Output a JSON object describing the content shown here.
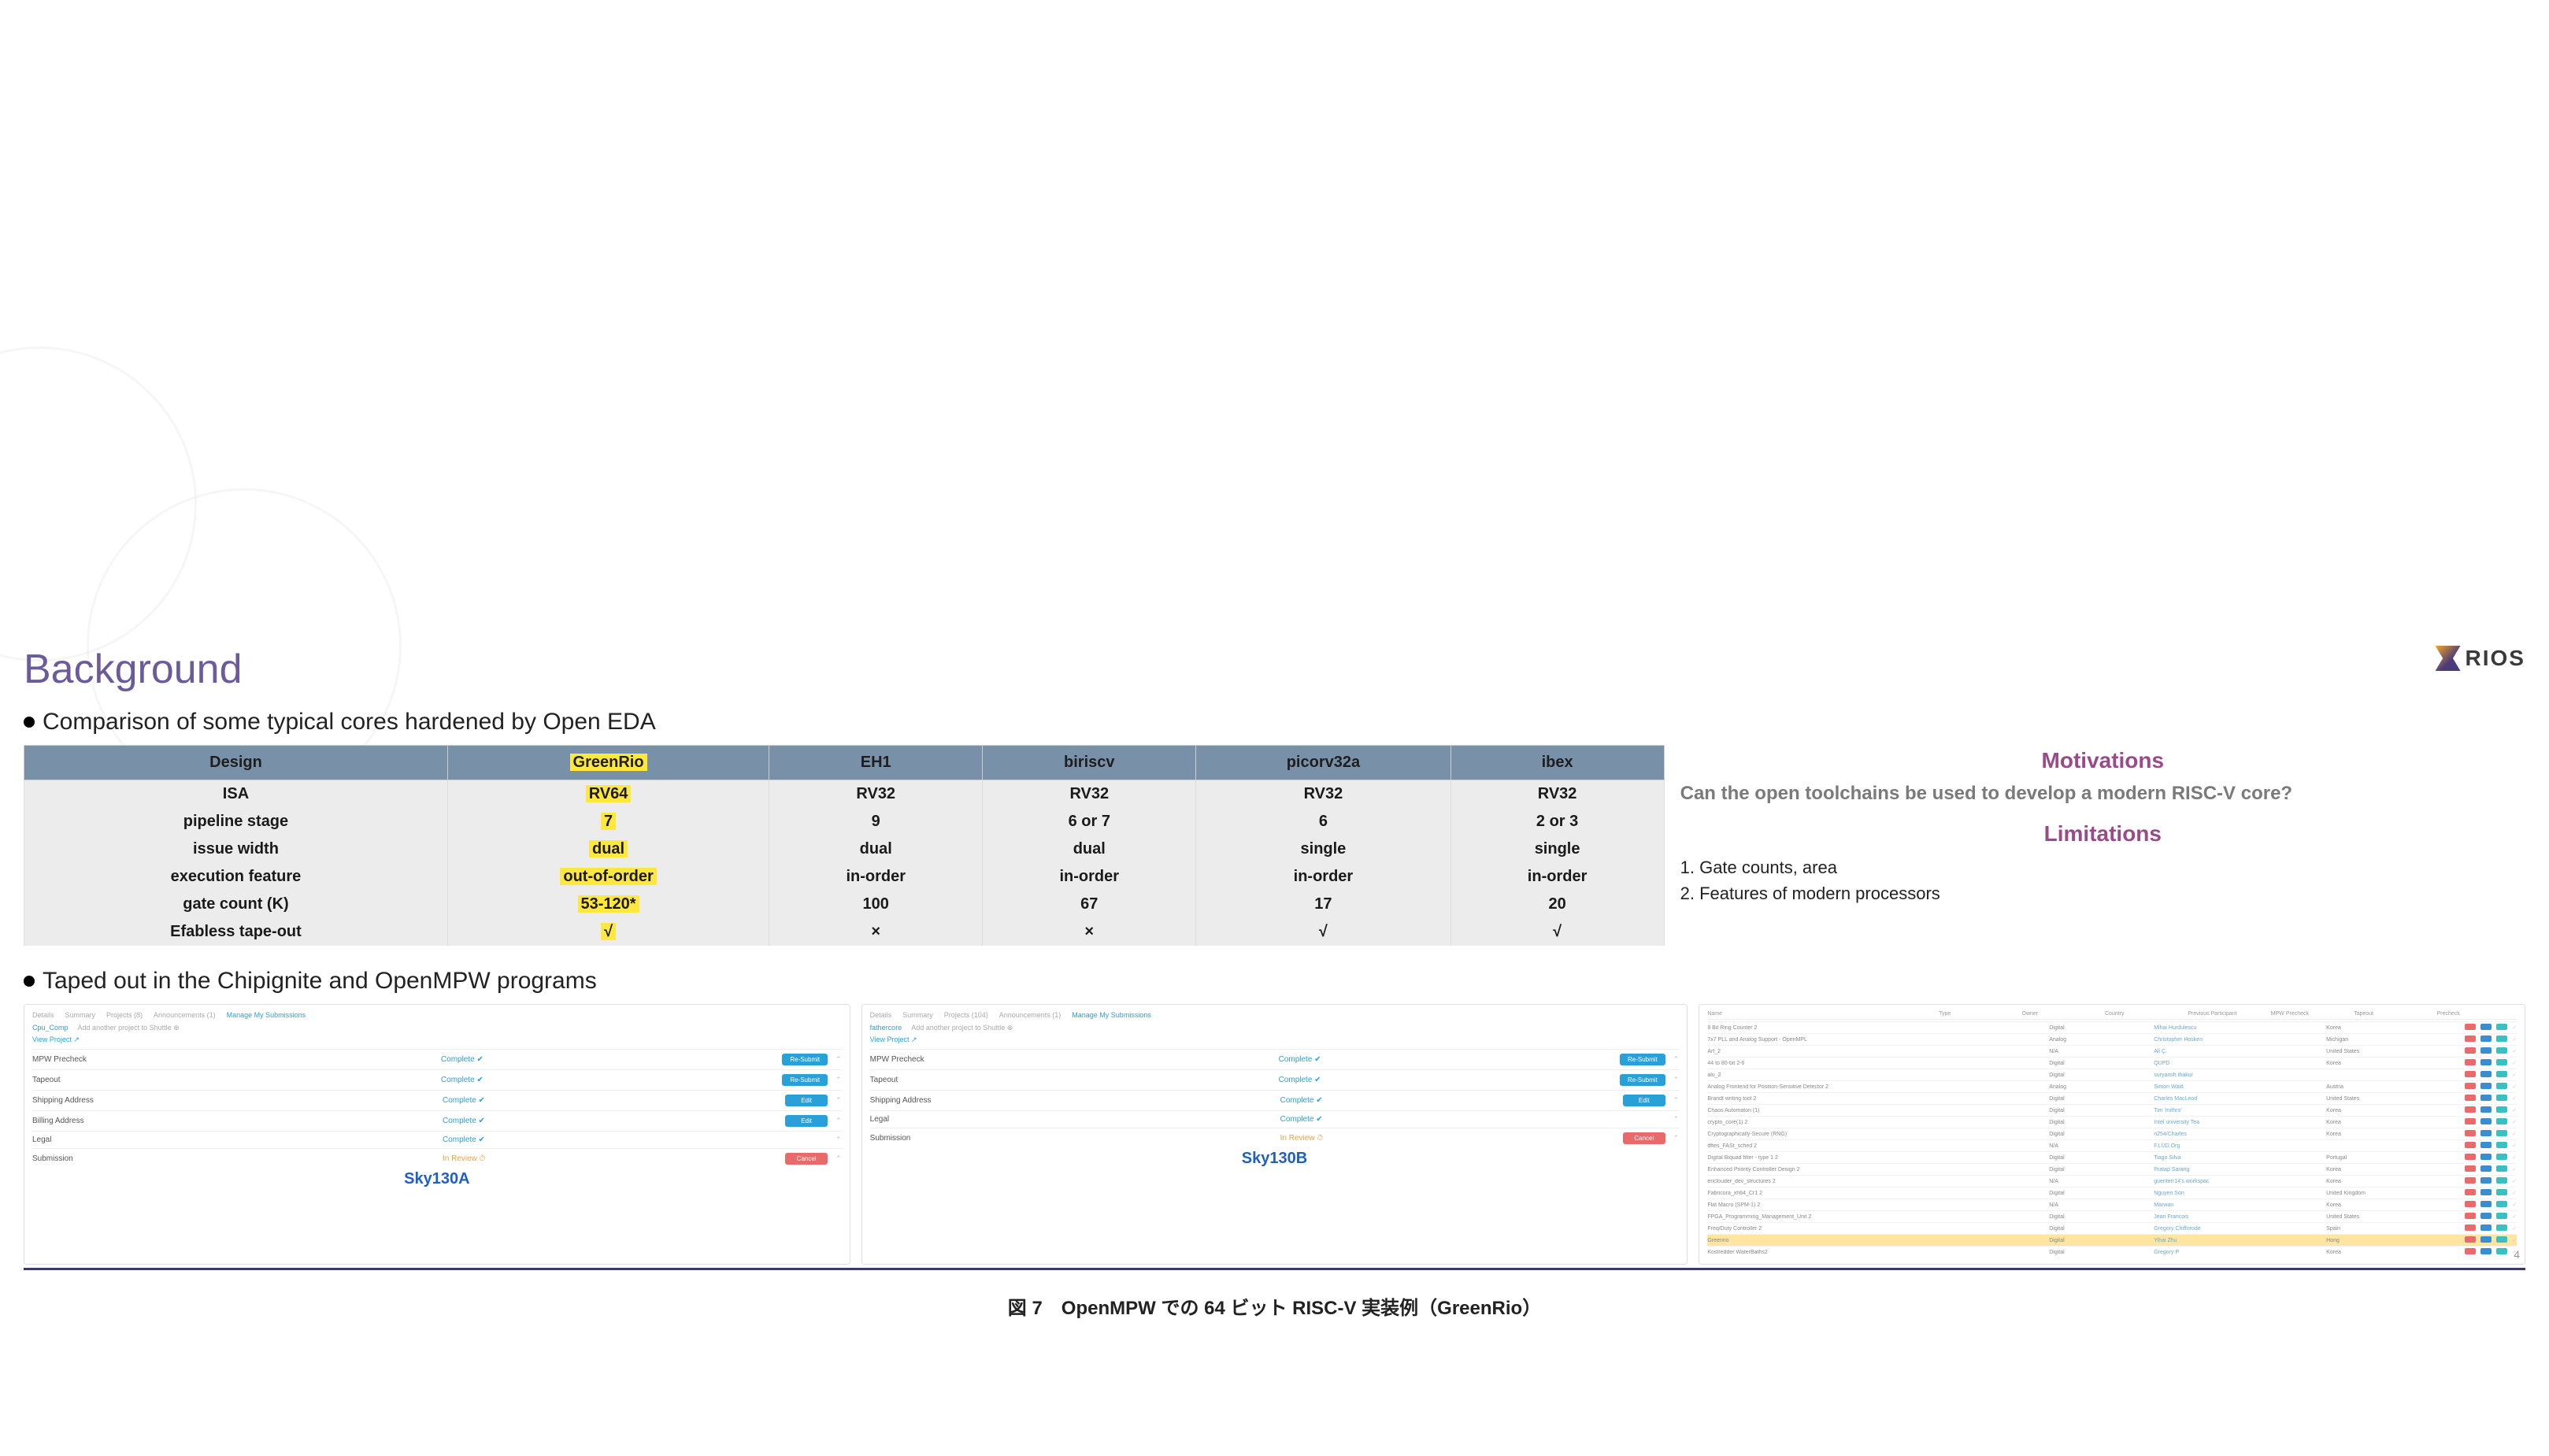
{
  "logo": {
    "text": "RIOS"
  },
  "title": "Background",
  "bullet1": "Comparison of some typical cores hardened by Open EDA",
  "bullet2": "Taped out in the Chipignite and OpenMPW programs",
  "table": {
    "headers": [
      "Design",
      "GreenRio",
      "EH1",
      "biriscv",
      "picorv32a",
      "ibex"
    ],
    "rows": {
      "isa": {
        "label": "ISA",
        "green": "RV64",
        "eh1": "RV32",
        "bir": "RV32",
        "pico": "RV32",
        "ibex": "RV32"
      },
      "pipe": {
        "label": "pipeline stage",
        "green": "7",
        "eh1": "9",
        "bir": "6 or 7",
        "pico": "6",
        "ibex": "2 or 3"
      },
      "issue": {
        "label": "issue width",
        "green": "dual",
        "eh1": "dual",
        "bir": "dual",
        "pico": "single",
        "ibex": "single"
      },
      "exec": {
        "label": "execution feature",
        "green": "out-of-order",
        "eh1": "in-order",
        "bir": "in-order",
        "pico": "in-order",
        "ibex": "in-order"
      },
      "gate": {
        "label": "gate count (K)",
        "green": "53-120*",
        "eh1": "100",
        "bir": "67",
        "pico": "17",
        "ibex": "20"
      },
      "tape": {
        "label": "Efabless tape-out",
        "green": "√",
        "eh1": "×",
        "bir": "×",
        "pico": "√",
        "ibex": "√"
      }
    }
  },
  "side": {
    "motivations_head": "Motivations",
    "question": "Can the open toolchains be used to develop a modern RISC-V core?",
    "limitations_head": "Limitations",
    "lim1": "1. Gate counts, area",
    "lim2": "2. Features of modern processors"
  },
  "panelA": {
    "tabs": [
      "Details",
      "Summary",
      "Projects (8)",
      "Announcements (1)",
      "Manage My Submissions"
    ],
    "project": "Cpu_Comp",
    "add": "Add another project to Shuttle ⊕",
    "view": "View Project ↗",
    "rows": [
      {
        "label": "MPW Precheck",
        "status": "Complete ✔",
        "btn": "Re-Submit",
        "btnColor": "blue"
      },
      {
        "label": "Tapeout",
        "status": "Complete ✔",
        "btn": "Re-Submit",
        "btnColor": "blue"
      },
      {
        "label": "Shipping Address",
        "status": "Complete ✔",
        "btn": "Edit",
        "btnColor": "blue"
      },
      {
        "label": "Billing Address",
        "status": "Complete ✔",
        "btn": "Edit",
        "btnColor": "blue"
      },
      {
        "label": "Legal",
        "status": "Complete ✔",
        "btn": "",
        "btnColor": ""
      },
      {
        "label": "Submission",
        "status": "In Review ⏱",
        "btn": "Cancel",
        "btnColor": "red",
        "orange": true
      }
    ],
    "caption": "Sky130A"
  },
  "panelB": {
    "tabs": [
      "Details",
      "Summary",
      "Projects (104)",
      "Announcements (1)",
      "Manage My Submissions"
    ],
    "project": "fathercore",
    "add": "Add another project to Shuttle ⊕",
    "view": "View Project ↗",
    "rows": [
      {
        "label": "MPW Precheck",
        "status": "Complete ✔",
        "btn": "Re-Submit",
        "btnColor": "blue"
      },
      {
        "label": "Tapeout",
        "status": "Complete ✔",
        "btn": "Re-Submit",
        "btnColor": "blue"
      },
      {
        "label": "Shipping Address",
        "status": "Complete ✔",
        "btn": "Edit",
        "btnColor": "blue"
      },
      {
        "label": "Legal",
        "status": "Complete ✔",
        "btn": "",
        "btnColor": ""
      },
      {
        "label": "Submission",
        "status": "In Review ⏱",
        "btn": "Cancel",
        "btnColor": "red",
        "orange": true
      }
    ],
    "caption": "Sky130B"
  },
  "panelC": {
    "headers": [
      "Name",
      "Type",
      "Owner",
      "Country",
      "Previous Participant",
      "MPW Precheck",
      "Tapeout",
      "Precheck"
    ],
    "rows": [
      {
        "name": "9 Bit Ring Counter 2",
        "type": "Digital",
        "owner": "Mihai Hurdulescu",
        "country": "Korea",
        "hl": false
      },
      {
        "name": "7x7 PLL and Analog Support - OpenMPL",
        "type": "Analog",
        "owner": "Christopher Hosken",
        "country": "Michigan",
        "hl": false
      },
      {
        "name": "Arf_2",
        "type": "N/A",
        "owner": "Ali Ç.",
        "country": "United States",
        "hl": false
      },
      {
        "name": "44 to 80-bit 2-6",
        "type": "Digital",
        "owner": "QUPD",
        "country": "Korea",
        "hl": false
      },
      {
        "name": "alu_2",
        "type": "Digital",
        "owner": "suryansh thakur",
        "country": "",
        "hl": false
      },
      {
        "name": "Analog Frontend for Position-Sensitive Detector 2",
        "type": "Analog",
        "owner": "Simon Waid",
        "country": "Austria",
        "hl": false
      },
      {
        "name": "Brandt writing tool 2",
        "type": "Digital",
        "owner": "Charles MacLeod",
        "country": "United States",
        "hl": false
      },
      {
        "name": "Chaos Automaton (1)",
        "type": "Digital",
        "owner": "Tim 'mithro'",
        "country": "Korea",
        "hl": false
      },
      {
        "name": "crypto_core(1) 2",
        "type": "Digital",
        "owner": "Intel university Tea",
        "country": "Korea",
        "hl": false
      },
      {
        "name": "Cryptographically-Secure (RNG)",
        "type": "Digital",
        "owner": "n254/Charles",
        "country": "Korea",
        "hl": false
      },
      {
        "name": "dftes_FASt_sched 2",
        "type": "N/A",
        "owner": "F.LUD.Org",
        "country": "",
        "hl": false
      },
      {
        "name": "Digital Biquad filter - type 1 2",
        "type": "Digital",
        "owner": "Tiago Silva",
        "country": "Portugal",
        "hl": false
      },
      {
        "name": "Enhanced Priority Controller Design 2",
        "type": "Digital",
        "owner": "Pratap Sarang",
        "country": "Korea",
        "hl": false
      },
      {
        "name": "ericlouder_dev_structures 2",
        "type": "N/A",
        "owner": "guenterr14's workspac",
        "country": "Korea",
        "hl": false
      },
      {
        "name": "Fabricora_xh64_Cr1 2",
        "type": "Digital",
        "owner": "Nguyen Son",
        "country": "United Kingdom",
        "hl": false
      },
      {
        "name": "Flat Macro (SPM-1) 2",
        "type": "N/A",
        "owner": "Marwan",
        "country": "Korea",
        "hl": false
      },
      {
        "name": "FPGA_Programming_Management_Unit 2",
        "type": "Digital",
        "owner": "Jean Francois",
        "country": "United States",
        "hl": false
      },
      {
        "name": "Freq/Duty Controller 2",
        "type": "Digital",
        "owner": "Gregory Chifforode",
        "country": "Spain",
        "hl": false
      },
      {
        "name": "Greenrio",
        "type": "Digital",
        "owner": "Yihai Zhu",
        "country": "Hong",
        "hl": true
      },
      {
        "name": "Kostredder WaterBaths2",
        "type": "Digital",
        "owner": "Gregory P",
        "country": "Korea",
        "hl": false
      }
    ]
  },
  "page_number": "4",
  "caption": "図 7　OpenMPW での 64 ビット RISC-V 実装例（GreenRio）"
}
